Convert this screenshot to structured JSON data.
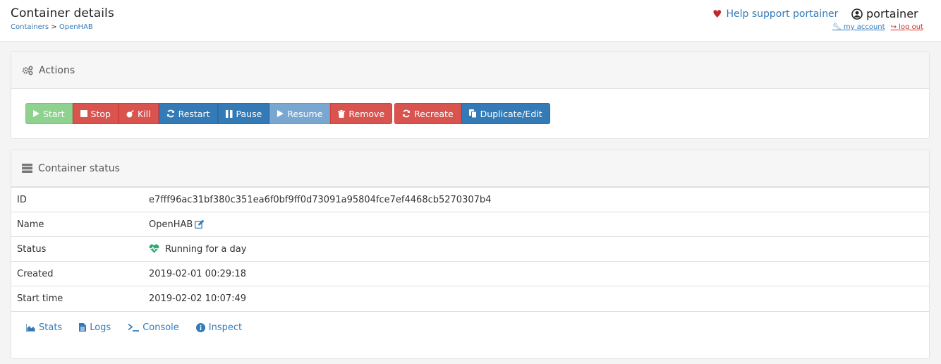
{
  "header": {
    "title": "Container details",
    "breadcrumb": {
      "parent": "Containers",
      "separator": ">",
      "current": "OpenHAB"
    },
    "support_label": "Help support portainer",
    "username": "portainer",
    "my_account": "my account",
    "log_out": "log out"
  },
  "actions": {
    "title": "Actions",
    "buttons": {
      "start": "Start",
      "stop": "Stop",
      "kill": "Kill",
      "restart": "Restart",
      "pause": "Pause",
      "resume": "Resume",
      "remove": "Remove",
      "recreate": "Recreate",
      "duplicate": "Duplicate/Edit"
    }
  },
  "status": {
    "title": "Container status",
    "rows": [
      {
        "label": "ID",
        "value": "e7fff96ac31bf380c351ea6f0bf9ff0d73091a95804fce7ef4468cb5270307b4"
      },
      {
        "label": "Name",
        "value": "OpenHAB"
      },
      {
        "label": "Status",
        "value": "Running for a day"
      },
      {
        "label": "Created",
        "value": "2019-02-01 00:29:18"
      },
      {
        "label": "Start time",
        "value": "2019-02-02 10:07:49"
      }
    ],
    "tabs": {
      "stats": "Stats",
      "logs": "Logs",
      "console": "Console",
      "inspect": "Inspect"
    }
  },
  "colors": {
    "link": "#337ab7",
    "danger": "#d9534f",
    "primary": "#337ab7",
    "success_disabled": "#8fd18f",
    "running": "#2fa876",
    "heart": "#c0292b"
  },
  "icons": {
    "support": "heart-icon",
    "user": "user-circle-icon",
    "account": "wrench-icon",
    "logout": "sign-out-icon",
    "actions_header": "cogs-icon",
    "status_header": "server-icon",
    "start": "play-icon",
    "stop": "stop-icon",
    "kill": "bomb-icon",
    "restart": "refresh-icon",
    "pause": "pause-icon",
    "resume": "play-icon",
    "remove": "trash-icon",
    "recreate": "refresh-icon",
    "duplicate": "copy-icon",
    "name_edit": "edit-icon",
    "status_running": "heartbeat-icon",
    "stats": "area-chart-icon",
    "logs": "file-text-icon",
    "console": "terminal-icon",
    "inspect": "info-circle-icon"
  }
}
